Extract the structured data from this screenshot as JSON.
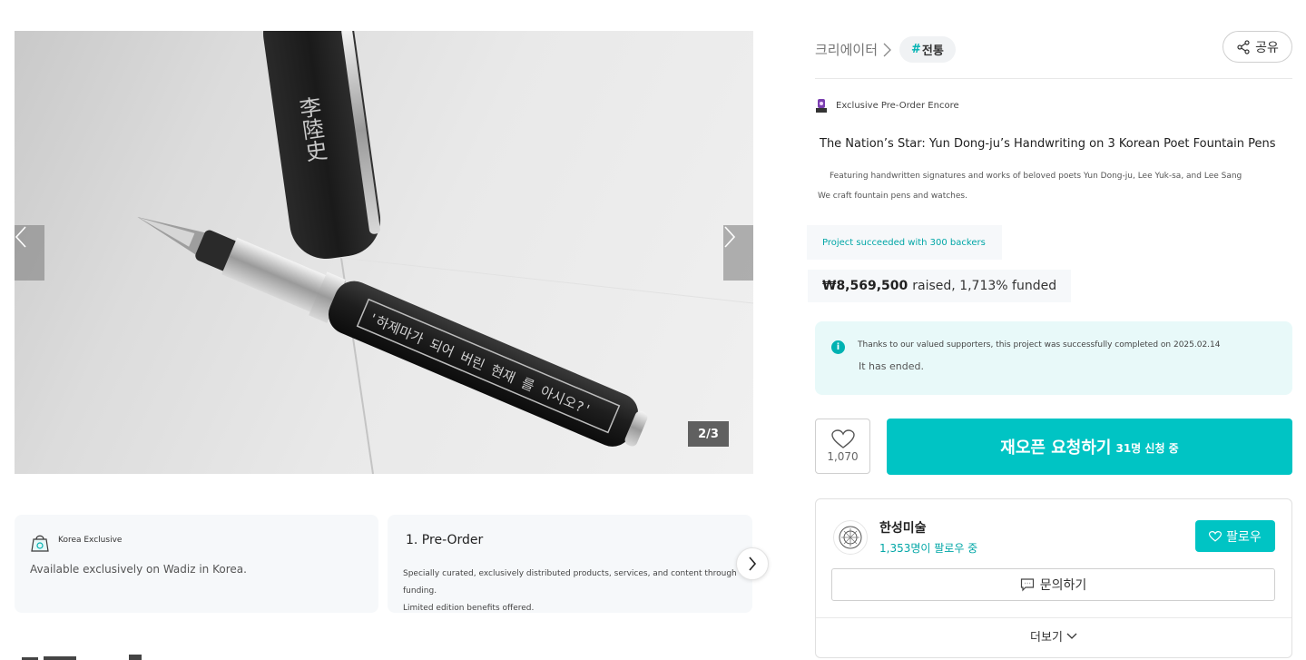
{
  "gallery": {
    "counter": "2/3",
    "pen_engraving": "'하제마가 되어 버린 현재 를 아시오?'",
    "cap_engraving": "李陸史"
  },
  "cards": [
    {
      "badge": "Korea Exclusive",
      "desc": "Available exclusively on Wadiz in Korea."
    },
    {
      "title": "1. Pre-Order",
      "desc_line1": "Specially curated, exclusively distributed products, services, and content through funding.",
      "desc_line2": "Limited edition benefits offered."
    }
  ],
  "header": {
    "crumb": "크리에이터",
    "tag_hash": "#",
    "tag": "전통",
    "share": "공유"
  },
  "project": {
    "encore": "Exclusive Pre-Order Encore",
    "title": "The Nation’s Star: Yun Dong-ju’s Handwriting on 3 Korean Poet Fountain Pens",
    "subtitle": "Featuring handwritten signatures and works of beloved poets Yun Dong-ju, Lee Yuk-sa, and Lee Sang",
    "craft": "We craft fountain pens and watches.",
    "success": "Project succeeded with 300 backers",
    "raised_amount": "₩8,569,500",
    "raised_rest": "raised, 1,713% funded"
  },
  "notice": {
    "info": "i",
    "message": "Thanks to our valued supporters, this project was successfully completed on 2025.02.14",
    "status": "It has ended."
  },
  "actions": {
    "like_count": "1,070",
    "cta_main": "재오픈 요청하기",
    "cta_sub": "31명 신청 중"
  },
  "maker": {
    "name": "한성미술",
    "followers": "1,353명이 팔로우 중",
    "follow": "팔로우",
    "inquiry": "문의하기",
    "more": "더보기"
  },
  "colors": {
    "accent": "#00c4c4",
    "accent_text": "#00a6a6",
    "notice_bg": "#e8f9f9"
  }
}
